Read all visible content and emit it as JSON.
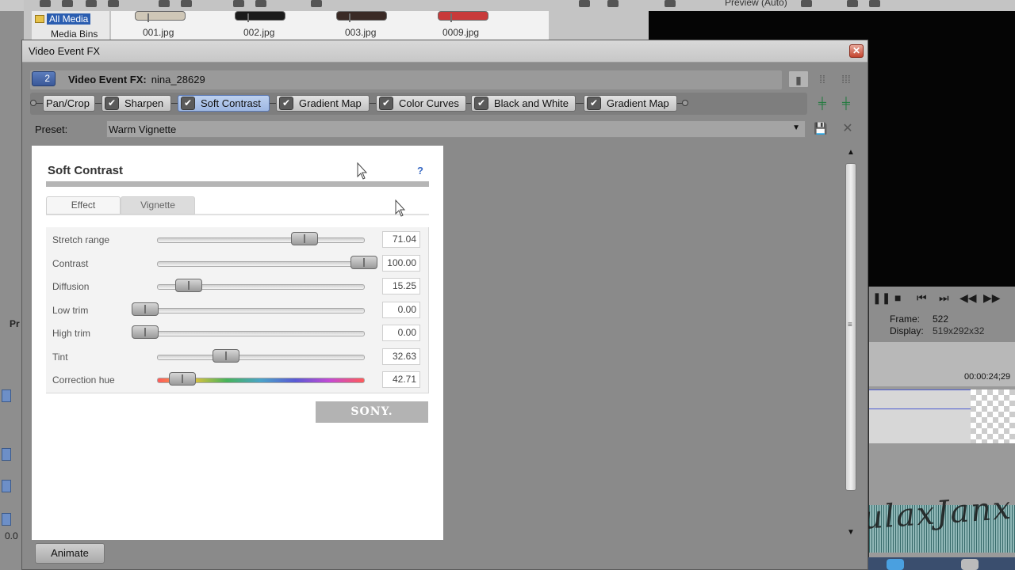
{
  "background": {
    "media_tree": {
      "items": [
        "All Media",
        "Media Bins"
      ]
    },
    "thumbnails": [
      "001.jpg",
      "002.jpg",
      "003.jpg",
      "0009.jpg"
    ],
    "preview_mode": "Preview (Auto)",
    "left_labels": [
      "Pr",
      "0.0"
    ],
    "transport_info": {
      "frame_label": "Frame:",
      "frame_value": "522",
      "display_label": "Display:",
      "display_value": "519x292x32"
    },
    "timecode": "00:00:24;29",
    "watermark": "xPaulaxJanx"
  },
  "dialog": {
    "window_title": "Video Event FX",
    "header": {
      "number": "2",
      "label": "Video Event FX:",
      "media_name": "nina_28629"
    },
    "plugin_chain": [
      {
        "label": "Pan/Crop",
        "checked": false,
        "active": false
      },
      {
        "label": "Sharpen",
        "checked": true,
        "active": false
      },
      {
        "label": "Soft Contrast",
        "checked": true,
        "active": true
      },
      {
        "label": "Gradient Map",
        "checked": true,
        "active": false
      },
      {
        "label": "Color Curves",
        "checked": true,
        "active": false
      },
      {
        "label": "Black and White",
        "checked": true,
        "active": false
      },
      {
        "label": "Gradient Map",
        "checked": true,
        "active": false
      }
    ],
    "preset": {
      "label": "Preset:",
      "value": "Warm Vignette"
    },
    "panel": {
      "title": "Soft Contrast",
      "help": "?",
      "tabs": {
        "effect": "Effect",
        "vignette": "Vignette",
        "selected": "Effect"
      },
      "params": [
        {
          "label": "Stretch range",
          "value": "71.04",
          "fraction": 0.71
        },
        {
          "label": "Contrast",
          "value": "100.00",
          "fraction": 1.0
        },
        {
          "label": "Diffusion",
          "value": "15.25",
          "fraction": 0.15
        },
        {
          "label": "Low trim",
          "value": "0.00",
          "fraction": 0.0
        },
        {
          "label": "High trim",
          "value": "0.00",
          "fraction": 0.0
        },
        {
          "label": "Tint",
          "value": "32.63",
          "fraction": 0.33
        },
        {
          "label": "Correction hue",
          "value": "42.71",
          "fraction": 0.12
        }
      ],
      "brand": "SONY."
    },
    "animate_label": "Animate",
    "colors": {
      "active_plugin": "#aac0e8",
      "header_number": "#4a68aa",
      "close_button": "#c4452f"
    }
  }
}
